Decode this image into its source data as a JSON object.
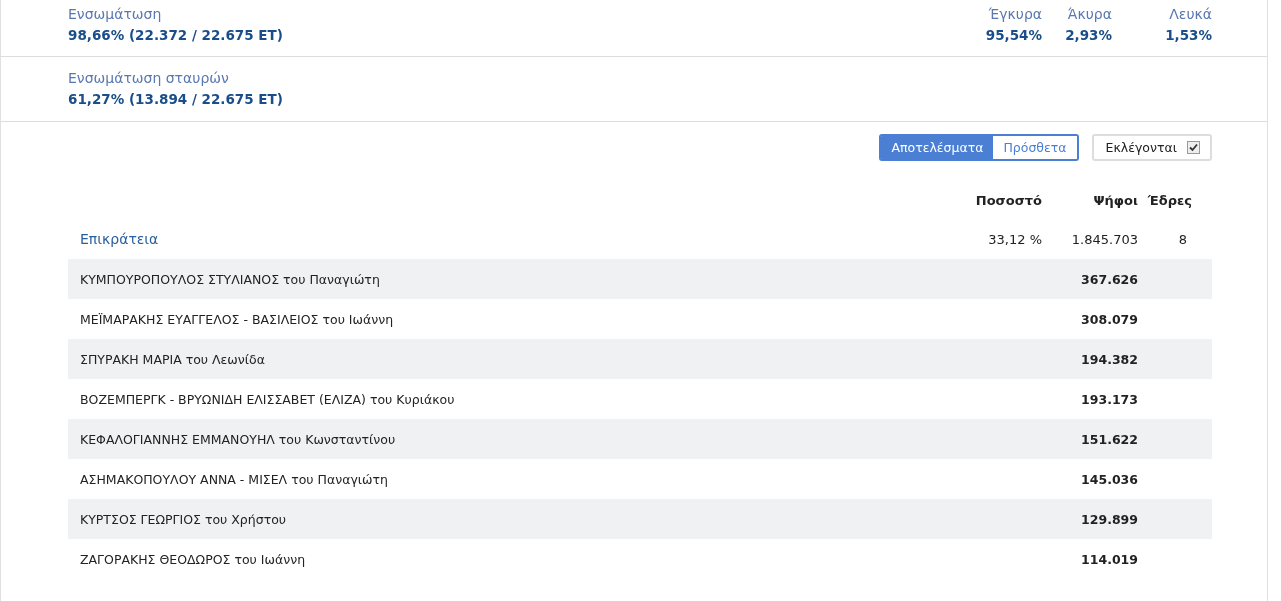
{
  "turnout": {
    "label": "Ενσωμάτωση",
    "value": "98,66% (22.372 / 22.675 ΕΤ)"
  },
  "stats": [
    {
      "label": "Έγκυρα",
      "value": "95,54%"
    },
    {
      "label": "Άκυρα",
      "value": "2,93%"
    },
    {
      "label": "Λευκά",
      "value": "1,53%"
    }
  ],
  "cross_turnout": {
    "label": "Ενσωμάτωση σταυρών",
    "value": "61,27% (13.894 / 22.675 ΕΤ)"
  },
  "view_tabs": [
    {
      "label": "Αποτελέσματα",
      "selected": true
    },
    {
      "label": "Πρόσθετα",
      "selected": false
    }
  ],
  "elected_filter": {
    "label": "Εκλέγονται",
    "checked": true
  },
  "table": {
    "columns": [
      "Ποσοστό",
      "Ψήφοι",
      "Έδρες"
    ],
    "rows": [
      {
        "kind": "party",
        "name": "Επικράτεια",
        "percent": "33,12 %",
        "votes": "1.845.703",
        "seats": "8"
      },
      {
        "kind": "candidate",
        "name": "ΚΥΜΠΟΥΡΟΠΟΥΛΟΣ ΣΤΥΛΙΑΝΟΣ του Παναγιώτη",
        "votes": "367.626"
      },
      {
        "kind": "candidate",
        "name": "ΜΕΪΜΑΡΑΚΗΣ ΕΥΑΓΓΕΛΟΣ - ΒΑΣΙΛΕΙΟΣ του Ιωάννη",
        "votes": "308.079"
      },
      {
        "kind": "candidate",
        "name": "ΣΠΥΡΑΚΗ ΜΑΡΙΑ του Λεωνίδα",
        "votes": "194.382"
      },
      {
        "kind": "candidate",
        "name": "ΒΟΖΕΜΠΕΡΓΚ - ΒΡΥΩΝΙΔΗ ΕΛΙΣΣΑΒΕΤ (ΕΛΙΖΑ) του Κυριάκου",
        "votes": "193.173"
      },
      {
        "kind": "candidate",
        "name": "ΚΕΦΑΛΟΓΙΑΝΝΗΣ ΕΜΜΑΝΟΥΗΛ του Κωνσταντίνου",
        "votes": "151.622"
      },
      {
        "kind": "candidate",
        "name": "ΑΣΗΜΑΚΟΠΟΥΛΟΥ ΑΝΝΑ - ΜΙΣΕΛ του Παναγιώτη",
        "votes": "145.036"
      },
      {
        "kind": "candidate",
        "name": "ΚΥΡΤΣΟΣ ΓΕΩΡΓΙΟΣ του Χρήστου",
        "votes": "129.899"
      },
      {
        "kind": "candidate",
        "name": "ΖΑΓΟΡΑΚΗΣ ΘΕΟΔΩΡΟΣ του Ιωάννη",
        "votes": "114.019"
      }
    ]
  }
}
